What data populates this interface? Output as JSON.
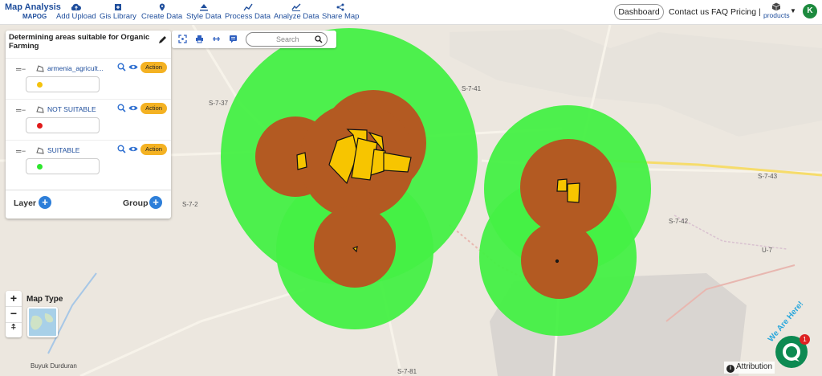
{
  "app": {
    "logo_line1": "Map Analysis",
    "logo_line2": "MAPOG"
  },
  "nav": [
    {
      "label": "Add Upload",
      "icon": "cloud-upload-icon"
    },
    {
      "label": "Gis Library",
      "icon": "library-icon"
    },
    {
      "label": "Create Data",
      "icon": "map-pin-icon"
    },
    {
      "label": "Style Data",
      "icon": "style-icon"
    },
    {
      "label": "Process Data",
      "icon": "process-icon"
    },
    {
      "label": "Analyze Data",
      "icon": "analyze-icon"
    },
    {
      "label": "Share Map",
      "icon": "share-icon"
    }
  ],
  "header_right": {
    "dashboard": "Dashboard",
    "contact": "Contact us",
    "faq": "FAQ",
    "pricing": "Pricing |",
    "products": "products",
    "avatar_letter": "K"
  },
  "panel": {
    "title": "Determining areas suitable for Organic Farming",
    "layers": [
      {
        "name": "armenia_agricult...",
        "action": "Action",
        "dot_color": "#f4c20d"
      },
      {
        "name": "NOT SUITABLE",
        "action": "Action",
        "dot_color": "#e01b1b"
      },
      {
        "name": "SUITABLE",
        "action": "Action",
        "dot_color": "#2ee62e"
      }
    ],
    "layer_label": "Layer",
    "group_label": "Group"
  },
  "toolbar": {
    "search_placeholder": "Search"
  },
  "map_type_label": "Map Type",
  "attribution": "Attribution",
  "chat_badge": "1",
  "we_are_here": "We Are Here!",
  "map_labels": {
    "road_s737": "S-7-37",
    "road_s741": "S-7-41",
    "road_s72": "S-7-2",
    "road_s742": "S-7-42",
    "road_s743": "S-7-43",
    "road_s781": "S-7-81",
    "road_u7": "U-7",
    "place_buyuk": "Buyuk Durduran"
  },
  "colors": {
    "suitable_green": "#44f044",
    "not_suitable_brown": "#b35a22",
    "agri_yellow": "#f7c500",
    "brand_blue": "#1f4e9c",
    "action_orange": "#f4b223"
  }
}
